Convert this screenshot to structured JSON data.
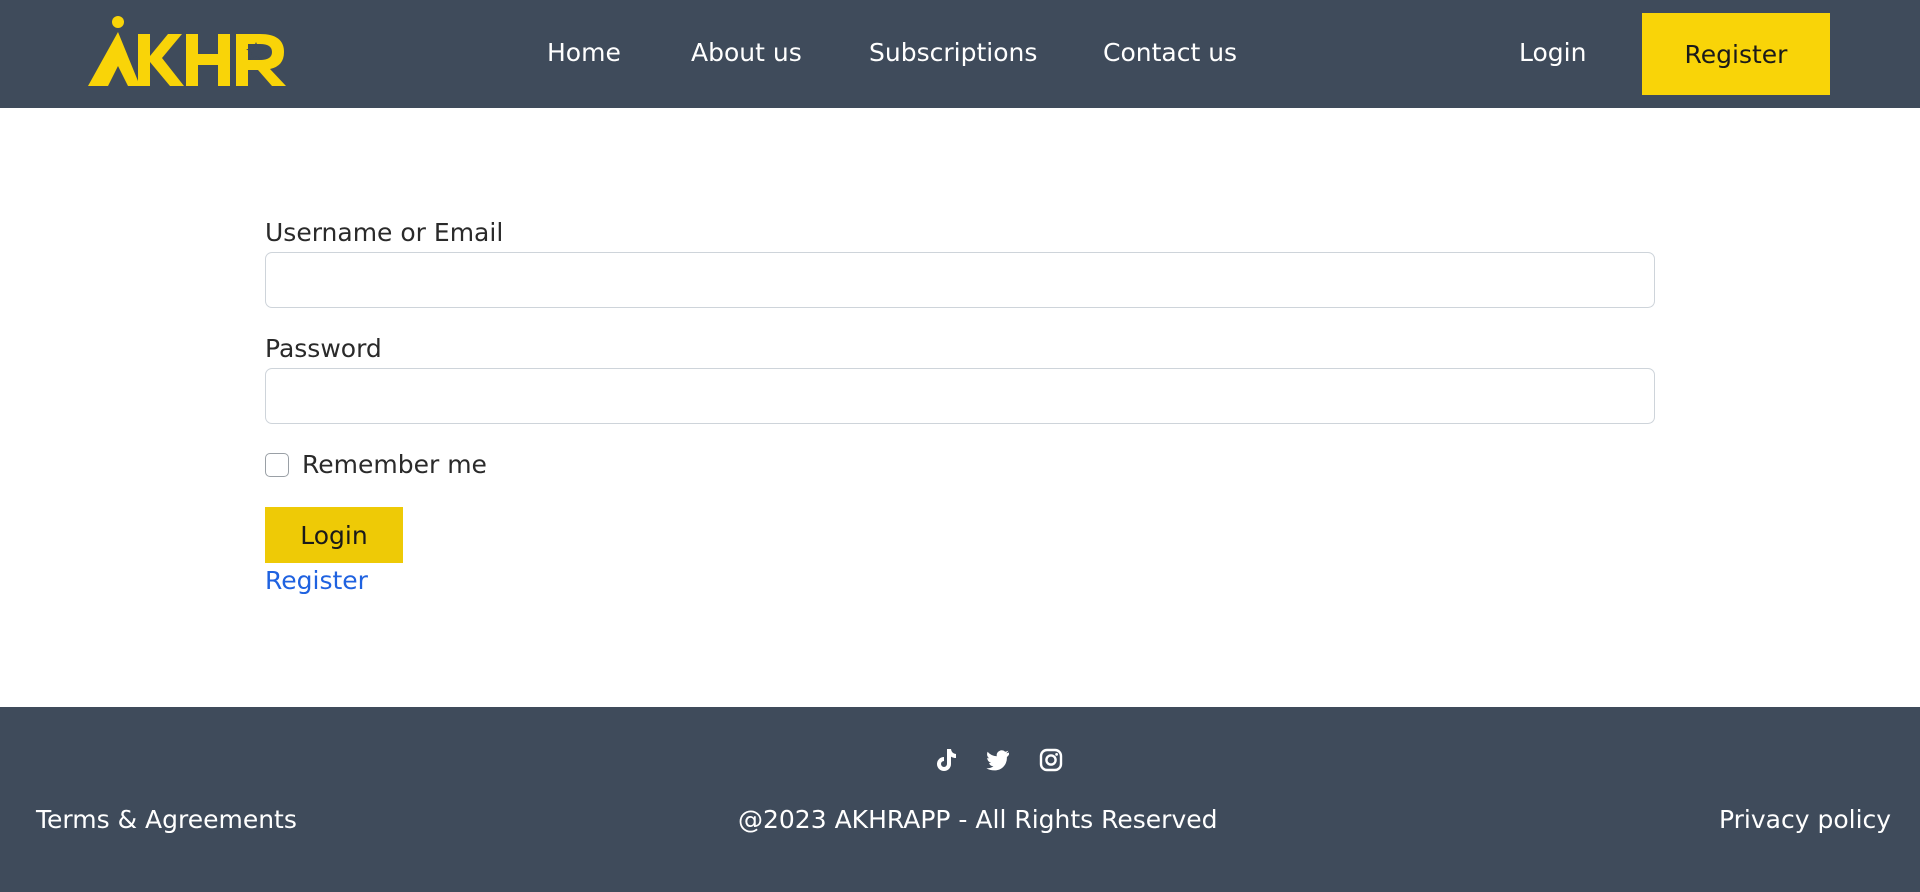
{
  "nav": {
    "logo_text": "AKHR",
    "links": [
      "Home",
      "About us",
      "Subscriptions",
      "Contact us"
    ],
    "login": "Login",
    "register": "Register"
  },
  "form": {
    "username_label": "Username or Email",
    "username_value": "",
    "password_label": "Password",
    "password_value": "",
    "remember_label": "Remember me",
    "remember_checked": false,
    "login_button": "Login",
    "register_link": "Register"
  },
  "footer": {
    "social_icons": [
      "tiktok-icon",
      "twitter-icon",
      "instagram-icon"
    ],
    "terms": "Terms & Agreements",
    "copyright": "@2023 AKHRAPP - All Rights Reserved",
    "privacy": "Privacy policy"
  },
  "colors": {
    "header_bg": "#3f4b5b",
    "accent": "#f9d408",
    "link": "#1f62e0"
  }
}
